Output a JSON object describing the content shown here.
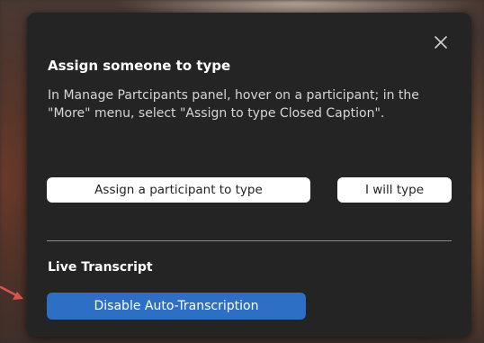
{
  "popup": {
    "title": "Assign someone to type",
    "description": "In Manage Partcipants panel, hover on a participant; in the \"More\" menu, select \"Assign to type Closed Caption\".",
    "assign_button_label": "Assign a participant to type",
    "self_type_button_label": "I will type",
    "close_icon": "close-icon",
    "live_transcript": {
      "heading": "Live Transcript",
      "disable_button_label": "Disable Auto-Transcription"
    }
  },
  "annotation": {
    "arrow_icon": "pointer-arrow-icon",
    "arrow_color": "#d9534f"
  },
  "colors": {
    "popup_background": "#242424",
    "accent_blue": "#2d6fc4"
  }
}
